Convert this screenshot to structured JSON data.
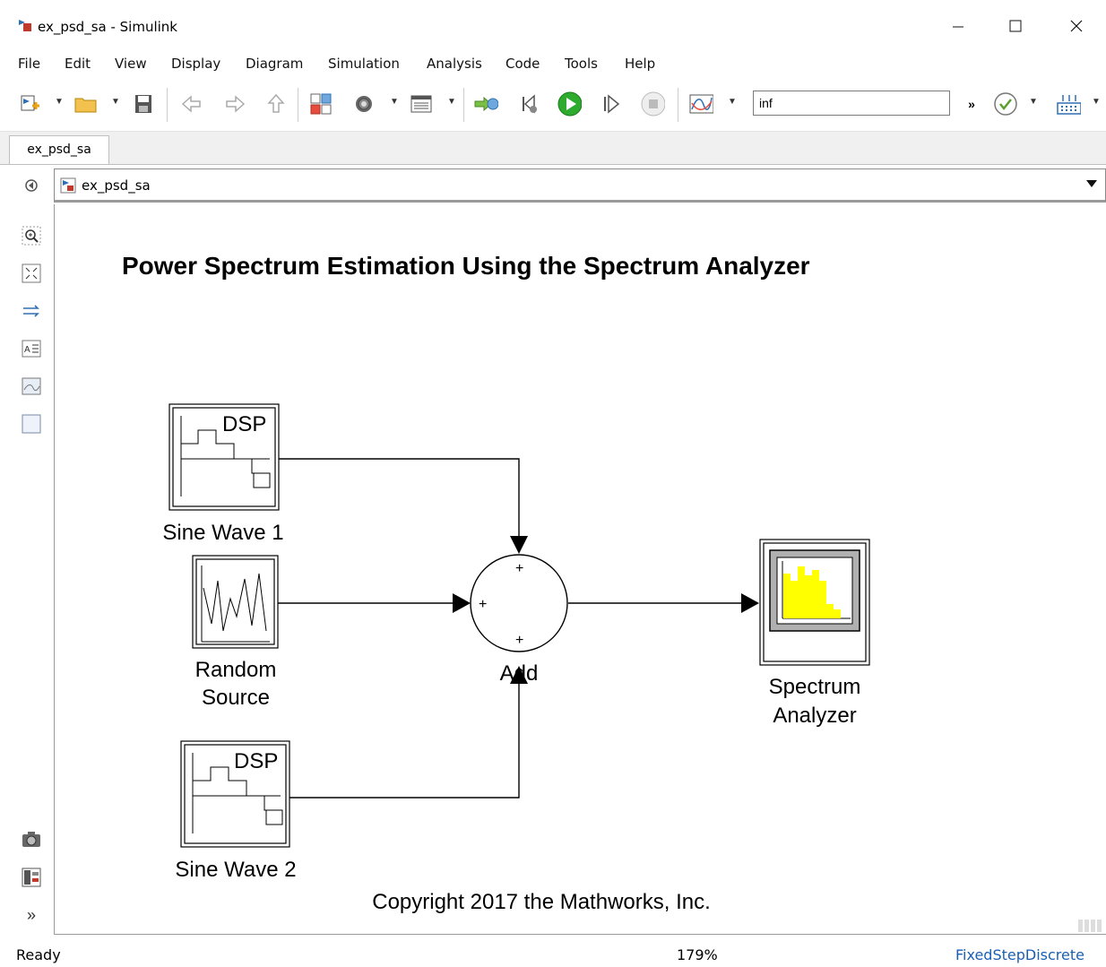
{
  "window": {
    "title": "ex_psd_sa - Simulink"
  },
  "menu": [
    "File",
    "Edit",
    "View",
    "Display",
    "Diagram",
    "Simulation",
    "Analysis",
    "Code",
    "Tools",
    "Help"
  ],
  "toolbar": {
    "stop_time": "inf",
    "more": "»"
  },
  "tab": {
    "label": "ex_psd_sa"
  },
  "address": {
    "path": "ex_psd_sa"
  },
  "model": {
    "title": "Power Spectrum Estimation Using the Spectrum Analyzer",
    "copyright": "Copyright 2017 the Mathworks, Inc.",
    "blocks": {
      "sine1": {
        "label": "Sine Wave 1",
        "mark": "DSP"
      },
      "random": {
        "label_line1": "Random",
        "label_line2": "Source"
      },
      "sine2": {
        "label": "Sine Wave 2",
        "mark": "DSP"
      },
      "add": {
        "label": "Add",
        "sign_top": "+",
        "sign_left": "+",
        "sign_bottom": "+"
      },
      "analyzer": {
        "label_line1": "Spectrum",
        "label_line2": "Analyzer"
      }
    }
  },
  "status": {
    "left": "Ready",
    "zoom": "179%",
    "solver": "FixedStepDiscrete"
  },
  "colors": {
    "analyzer_bars": "#ffff00",
    "accent": "#1a5fb4",
    "run_green": "#1e9e1e"
  }
}
